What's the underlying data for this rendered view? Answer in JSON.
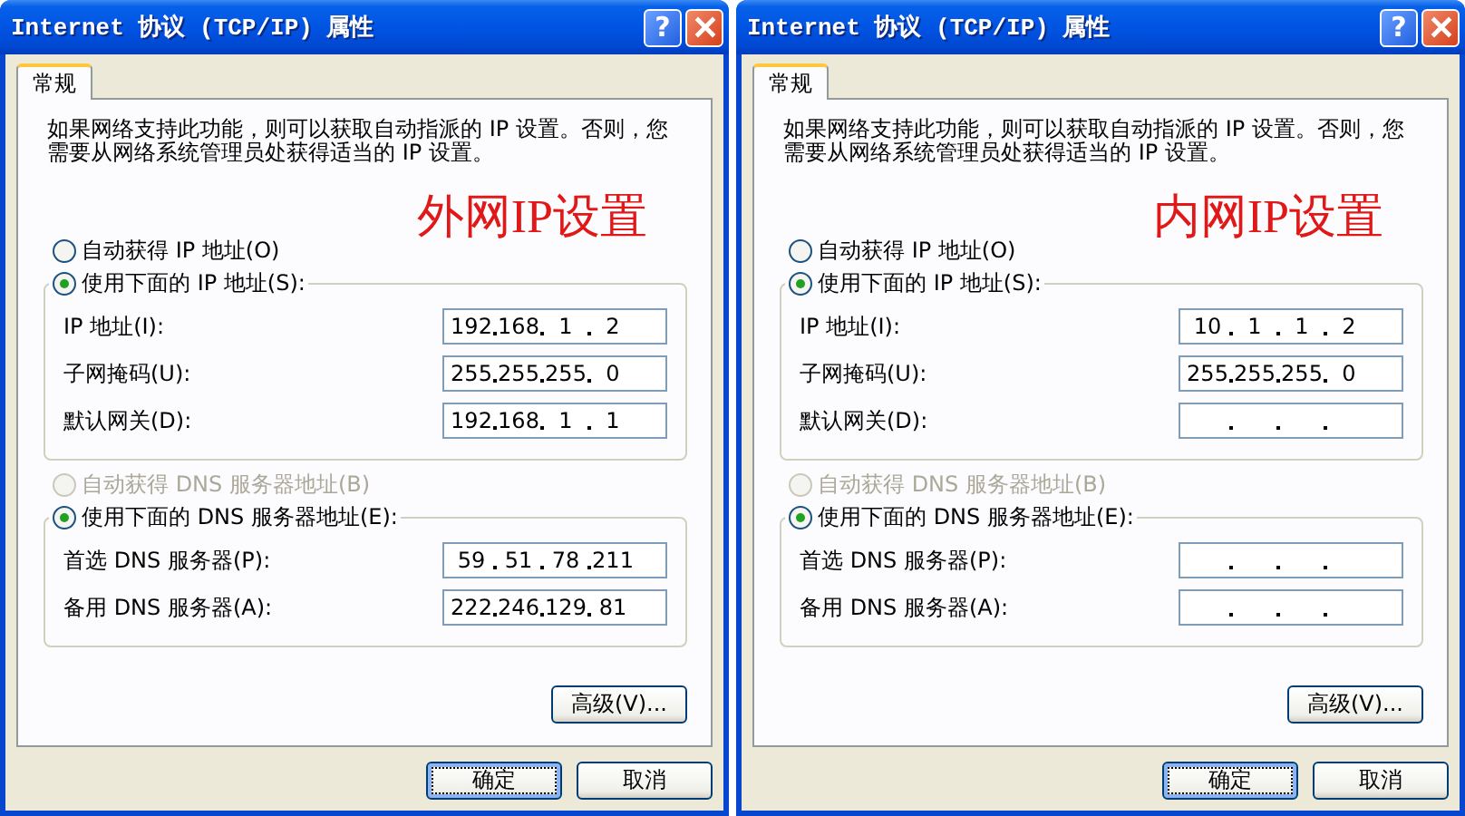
{
  "dialogs": [
    {
      "title": "Internet 协议 (TCP/IP) 属性",
      "help_button": "?",
      "tabs": [
        {
          "label": "常规",
          "selected": true
        }
      ],
      "description": "如果网络支持此功能，则可以获取自动指派的 IP 设置。否则，您需要从网络系统管理员处获得适当的 IP 设置。",
      "annotation": "外网IP设置",
      "ip": {
        "auto_option": {
          "label": "自动获得 IP 地址(O)",
          "selected": false,
          "disabled": false
        },
        "manual_option": {
          "label": "使用下面的 IP 地址(S):",
          "selected": true,
          "disabled": false
        },
        "fields": [
          {
            "label": "IP 地址(I):",
            "octets": [
              "192",
              "168",
              "1",
              "2"
            ]
          },
          {
            "label": "子网掩码(U):",
            "octets": [
              "255",
              "255",
              "255",
              "0"
            ]
          },
          {
            "label": "默认网关(D):",
            "octets": [
              "192",
              "168",
              "1",
              "1"
            ]
          }
        ]
      },
      "dns": {
        "auto_option": {
          "label": "自动获得 DNS 服务器地址(B)",
          "selected": false,
          "disabled": true
        },
        "manual_option": {
          "label": "使用下面的 DNS 服务器地址(E):",
          "selected": true,
          "disabled": false
        },
        "fields": [
          {
            "label": "首选 DNS 服务器(P):",
            "octets": [
              "59",
              "51",
              "78",
              "211"
            ]
          },
          {
            "label": "备用 DNS 服务器(A):",
            "octets": [
              "222",
              "246",
              "129",
              "81"
            ]
          }
        ]
      },
      "advanced_button": "高级(V)...",
      "buttons": [
        {
          "label": "确定",
          "default": true
        },
        {
          "label": "取消",
          "default": false
        }
      ]
    },
    {
      "title": "Internet 协议 (TCP/IP) 属性",
      "help_button": "?",
      "tabs": [
        {
          "label": "常规",
          "selected": true
        }
      ],
      "description": "如果网络支持此功能，则可以获取自动指派的 IP 设置。否则，您需要从网络系统管理员处获得适当的 IP 设置。",
      "annotation": "内网IP设置",
      "ip": {
        "auto_option": {
          "label": "自动获得 IP 地址(O)",
          "selected": false,
          "disabled": false
        },
        "manual_option": {
          "label": "使用下面的 IP 地址(S):",
          "selected": true,
          "disabled": false
        },
        "fields": [
          {
            "label": "IP 地址(I):",
            "octets": [
              "10",
              "1",
              "1",
              "2"
            ]
          },
          {
            "label": "子网掩码(U):",
            "octets": [
              "255",
              "255",
              "255",
              "0"
            ]
          },
          {
            "label": "默认网关(D):"
          }
        ]
      },
      "dns": {
        "auto_option": {
          "label": "自动获得 DNS 服务器地址(B)",
          "selected": false,
          "disabled": true
        },
        "manual_option": {
          "label": "使用下面的 DNS 服务器地址(E):",
          "selected": true,
          "disabled": false
        },
        "fields": [
          {
            "label": "首选 DNS 服务器(P):"
          },
          {
            "label": "备用 DNS 服务器(A):"
          }
        ]
      },
      "advanced_button": "高级(V)...",
      "buttons": [
        {
          "label": "确定",
          "default": true
        },
        {
          "label": "取消",
          "default": false
        }
      ]
    }
  ]
}
